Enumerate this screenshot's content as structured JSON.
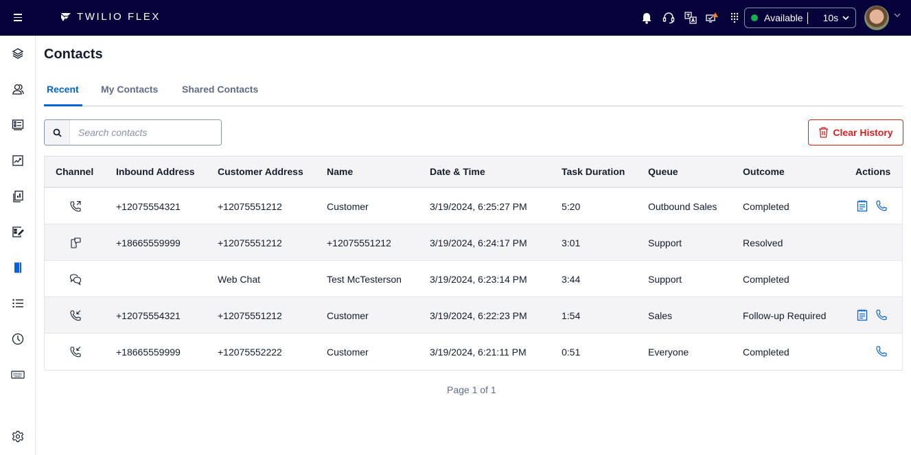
{
  "app": {
    "brand_name": "TWILIO FLEX",
    "colors": {
      "topbar": "#06033a",
      "accent": "#0263e0",
      "danger": "#d61f1f",
      "available": "#14b053"
    }
  },
  "topbar": {
    "icons": [
      "bell-icon",
      "headset-icon",
      "translate-icon",
      "alert-monitor-icon",
      "apps-grid-icon"
    ],
    "status": {
      "label": "Available",
      "timer": "10s"
    }
  },
  "sidebar": {
    "items": [
      {
        "name": "layers",
        "icon": "layers-icon"
      },
      {
        "name": "agents",
        "icon": "users-icon"
      },
      {
        "name": "queues",
        "icon": "list-card-icon"
      },
      {
        "name": "insights",
        "icon": "trend-chart-icon"
      },
      {
        "name": "reports",
        "icon": "bar-chart-icon"
      },
      {
        "name": "tasks",
        "icon": "edit-list-icon"
      },
      {
        "name": "contacts",
        "icon": "contact-book-icon",
        "active": true
      },
      {
        "name": "list",
        "icon": "list-icon"
      },
      {
        "name": "history",
        "icon": "clock-icon"
      },
      {
        "name": "keyboard",
        "icon": "keyboard-icon"
      },
      {
        "name": "settings",
        "icon": "gear-icon"
      }
    ]
  },
  "main": {
    "title": "Contacts",
    "tabs": [
      {
        "label": "Recent",
        "active": true
      },
      {
        "label": "My Contacts",
        "active": false
      },
      {
        "label": "Shared Contacts",
        "active": false
      }
    ],
    "search": {
      "placeholder": "Search contacts",
      "value": ""
    },
    "clear_history_label": "Clear History",
    "table": {
      "columns": [
        "Channel",
        "Inbound Address",
        "Customer Address",
        "Name",
        "Date & Time",
        "Task Duration",
        "Queue",
        "Outcome",
        "Actions"
      ],
      "rows": [
        {
          "channel": "outbound-call",
          "inbound": "+12075554321",
          "customer": "+12075551212",
          "name": "Customer",
          "datetime": "3/19/2024, 6:25:27 PM",
          "duration": "5:20",
          "queue": "Outbound Sales",
          "outcome": "Completed",
          "actions": [
            "notes",
            "call"
          ]
        },
        {
          "channel": "sms",
          "inbound": "+18665559999",
          "customer": "+12075551212",
          "name": "+12075551212",
          "datetime": "3/19/2024, 6:24:17 PM",
          "duration": "3:01",
          "queue": "Support",
          "outcome": "Resolved",
          "actions": []
        },
        {
          "channel": "webchat",
          "inbound": "",
          "customer": "Web Chat",
          "name": "Test McTesterson",
          "datetime": "3/19/2024, 6:23:14 PM",
          "duration": "3:44",
          "queue": "Support",
          "outcome": "Completed",
          "actions": []
        },
        {
          "channel": "inbound-call",
          "inbound": "+12075554321",
          "customer": "+12075551212",
          "name": "Customer",
          "datetime": "3/19/2024, 6:22:23 PM",
          "duration": "1:54",
          "queue": "Sales",
          "outcome": "Follow-up Required",
          "actions": [
            "notes",
            "call"
          ]
        },
        {
          "channel": "inbound-call",
          "inbound": "+18665559999",
          "customer": "+12075552222",
          "name": "Customer",
          "datetime": "3/19/2024, 6:21:11 PM",
          "duration": "0:51",
          "queue": "Everyone",
          "outcome": "Completed",
          "actions": [
            "call"
          ]
        }
      ]
    },
    "pagination": "Page 1 of 1"
  }
}
